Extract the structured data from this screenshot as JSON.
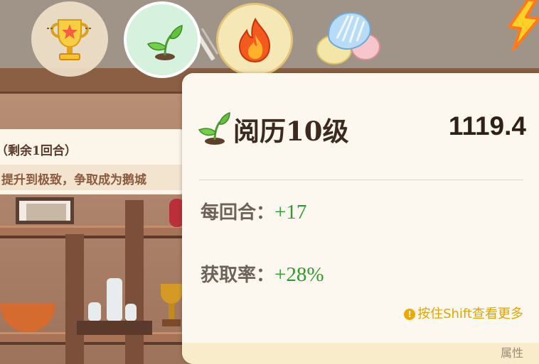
{
  "quest_card": {
    "title": "（剩余1回合）",
    "description": "提升到极致，争取成为鹅城"
  },
  "top_bar": {
    "icons": [
      "trophy-icon",
      "sprout-icon",
      "fire-icon",
      "shells-icon",
      "lightning-icon"
    ]
  },
  "tooltip": {
    "level_label": "阅历10级",
    "value": "1119.4",
    "per_round_label": "每回合：",
    "per_round_value": "+17",
    "gain_rate_label": "获取率：",
    "gain_rate_value": "+28%",
    "hint_text": "按住Shift查看更多",
    "footer_label": "属性"
  },
  "colors": {
    "panel_bg": "#fdf8ef",
    "positive_green": "#2f9b2f",
    "hint_yellow": "#e2a400",
    "title_brown": "#3c2a1e"
  }
}
